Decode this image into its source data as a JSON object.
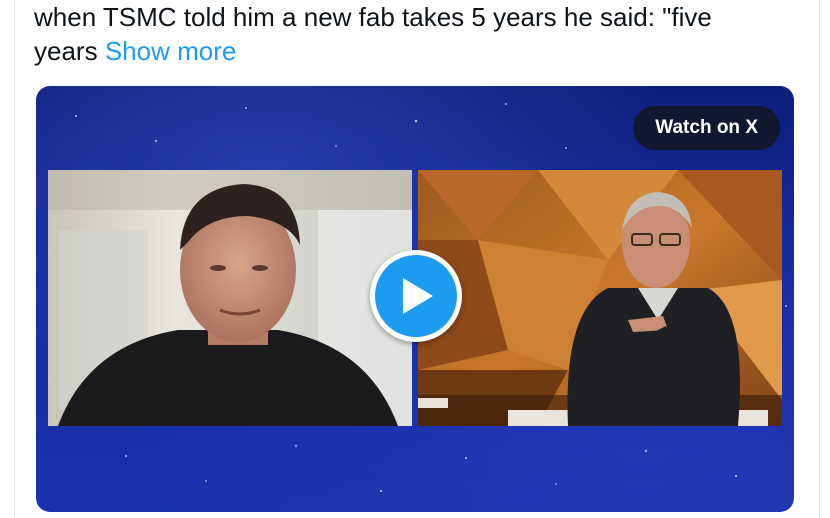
{
  "tweet": {
    "text_line1": "when TSMC told him a new fab takes 5 years he said: \"five",
    "text_line2": "years",
    "show_more_label": "Show more"
  },
  "media": {
    "watch_label": "Watch on X",
    "play_icon": "play-icon"
  },
  "colors": {
    "accent": "#1d9bf0",
    "media_bg": "#14289a",
    "watch_button_bg": "#0f1830"
  }
}
